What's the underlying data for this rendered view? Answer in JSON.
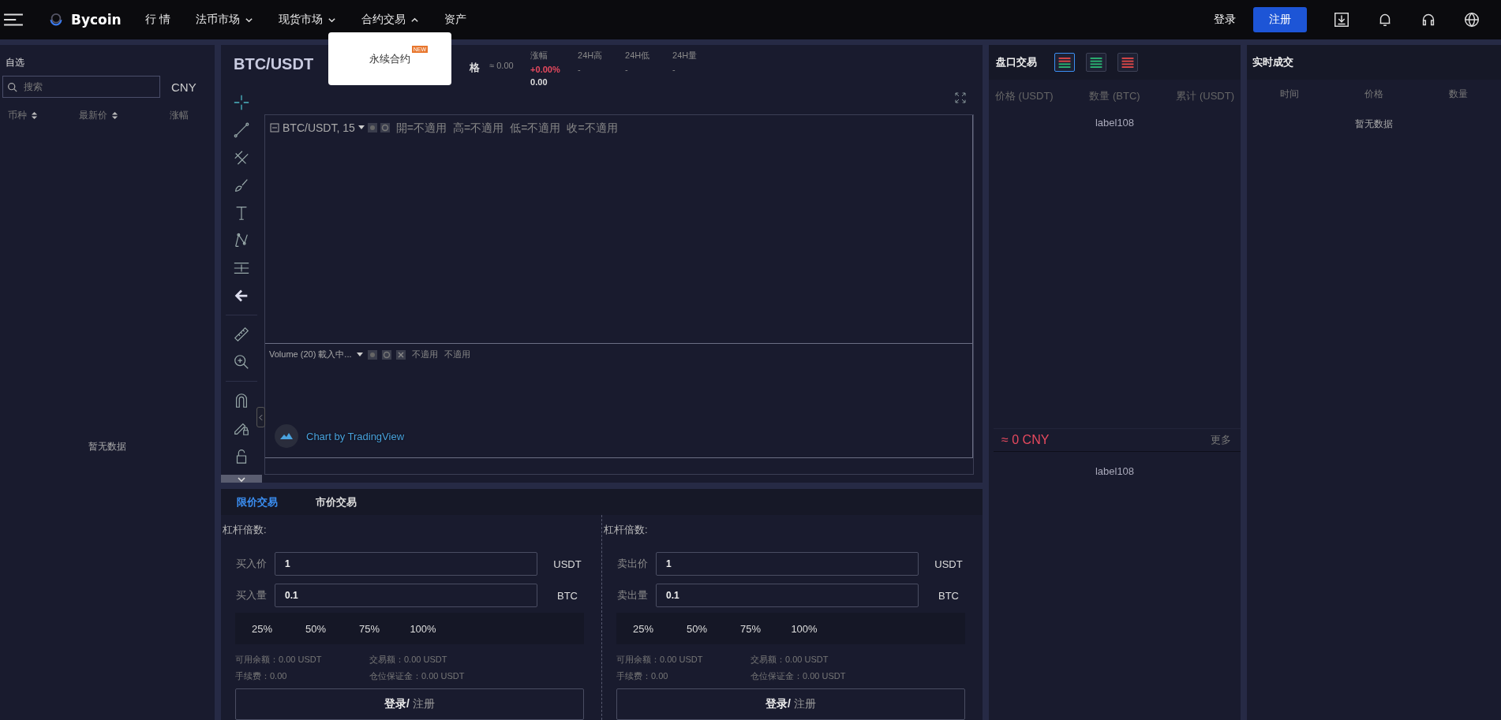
{
  "header": {
    "logo": "Bycoin",
    "nav": [
      {
        "label": "行 情",
        "dropdown": false,
        "expanded": false
      },
      {
        "label": "法币市场",
        "dropdown": true,
        "expanded": false
      },
      {
        "label": "现货市场",
        "dropdown": true,
        "expanded": false
      },
      {
        "label": "合约交易",
        "dropdown": true,
        "expanded": true
      },
      {
        "label": "资产",
        "dropdown": false,
        "expanded": false
      }
    ],
    "login": "登录",
    "register": "注册"
  },
  "dropdown_menu": {
    "items": [
      {
        "label": "永续合约",
        "badge": "NEW"
      }
    ]
  },
  "watchlist": {
    "title": "自选",
    "search": {
      "placeholder": "搜索"
    },
    "currency": "CNY",
    "columns": [
      {
        "label": "币种",
        "sortable": true
      },
      {
        "label": "最新价",
        "sortable": true
      },
      {
        "label": "涨幅",
        "sortable": false
      }
    ],
    "empty": "暂无数据"
  },
  "market_header": {
    "pair": "BTC/USDT",
    "price_label": "格",
    "price": "≈ 0.00",
    "stats": [
      {
        "kind": "change",
        "label": "涨幅",
        "value": "+0.00%",
        "sub": "0.00"
      },
      {
        "kind": "plain",
        "label": "24H高",
        "value": "-"
      },
      {
        "kind": "plain",
        "label": "24H低",
        "value": "-"
      },
      {
        "kind": "plain",
        "label": "24H量",
        "value": "-"
      }
    ]
  },
  "chart": {
    "legend": {
      "symbol": "BTC/USDT, 15",
      "values": [
        "開=不適用",
        "高=不適用",
        "低=不適用",
        "收=不適用"
      ]
    },
    "volume": {
      "label": "Volume (20) 載入中...",
      "values": [
        "不適用",
        "不適用"
      ]
    },
    "attribution": "Chart by TradingView"
  },
  "order_form": {
    "tabs": [
      {
        "label": "限价交易",
        "selected": true
      },
      {
        "label": "市价交易",
        "selected": false
      }
    ],
    "sides": [
      {
        "leverage_label": "杠杆倍数:",
        "fields": [
          {
            "label": "买入价",
            "value": "1",
            "unit": "USDT"
          },
          {
            "label": "买入量",
            "value": "0.1",
            "unit": "BTC"
          }
        ],
        "percents": [
          "25%",
          "50%",
          "75%",
          "100%"
        ],
        "info": [
          "可用余额：0.00 USDT",
          "交易额：0.00 USDT",
          "手续费：0.00",
          "仓位保证金：0.00 USDT"
        ],
        "button": "**登录/** 注册"
      },
      {
        "leverage_label": "杠杆倍数:",
        "fields": [
          {
            "label": "卖出价",
            "value": "1",
            "unit": "USDT"
          },
          {
            "label": "卖出量",
            "value": "0.1",
            "unit": "BTC"
          }
        ],
        "percents": [
          "25%",
          "50%",
          "75%",
          "100%"
        ],
        "info": [
          "可用余额：0.00 USDT",
          "交易额：0.00 USDT",
          "手续费：0.00",
          "仓位保证金：0.00 USDT"
        ],
        "button": "**登录/** 注册"
      }
    ]
  },
  "order_book": {
    "title": "盘口交易",
    "views": [
      {
        "kind": "both",
        "selected": true
      },
      {
        "kind": "buy",
        "selected": false
      },
      {
        "kind": "sell",
        "selected": false
      }
    ],
    "columns": [
      "价格 (USDT)",
      "数量 (BTC)",
      "累计 (USDT)"
    ],
    "asks_label": "label108",
    "last_price": "≈ 0 CNY",
    "more": "更多",
    "bids_label": "label108"
  },
  "trades": {
    "title": "实时成交",
    "columns": [
      "时间",
      "价格",
      "数量"
    ],
    "empty": "暂无数据"
  }
}
